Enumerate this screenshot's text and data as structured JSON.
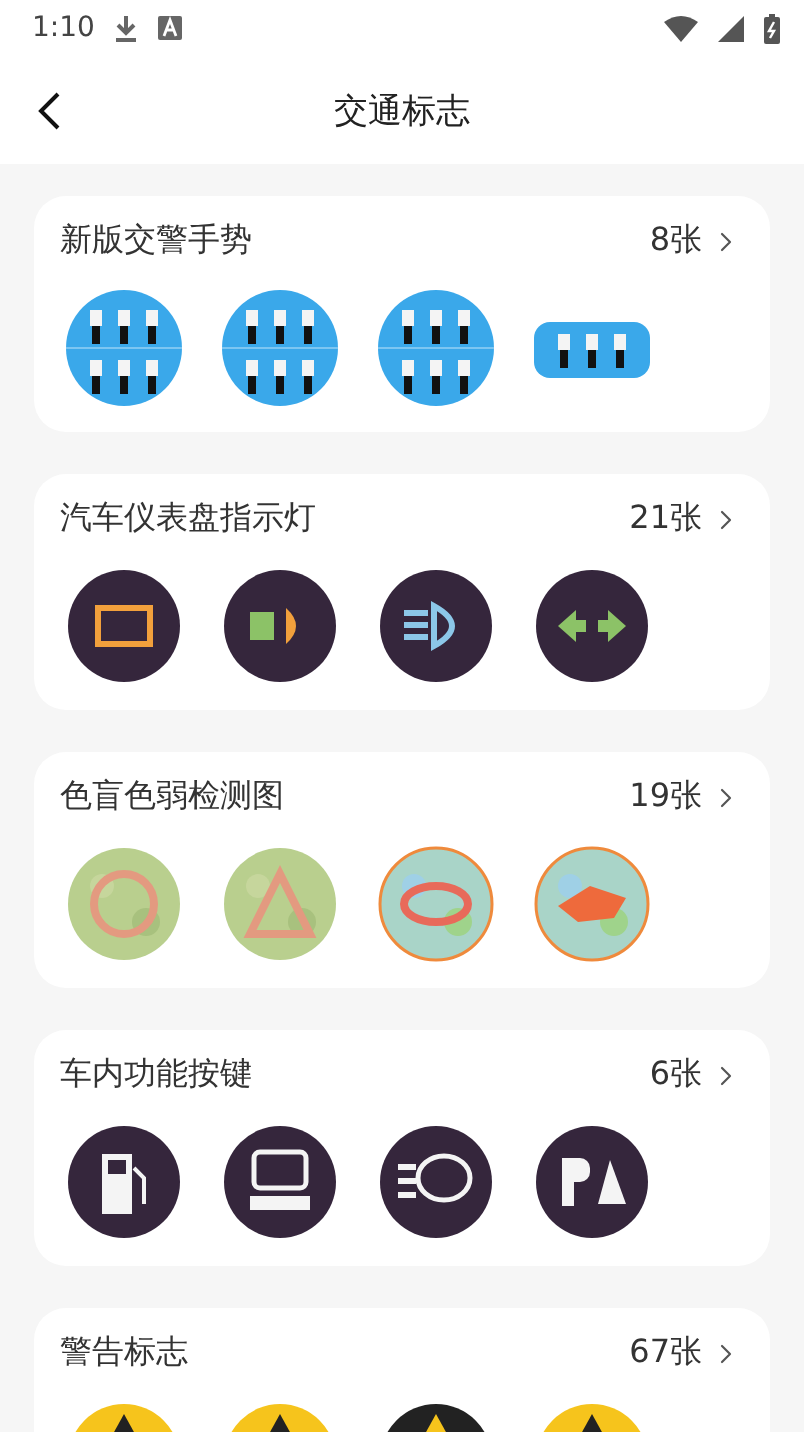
{
  "status_bar": {
    "time": "1:10"
  },
  "header": {
    "title": "交通标志"
  },
  "sections": [
    {
      "title": "新版交警手势",
      "count": "8张"
    },
    {
      "title": "汽车仪表盘指示灯",
      "count": "21张"
    },
    {
      "title": "色盲色弱检测图",
      "count": "19张"
    },
    {
      "title": "车内功能按键",
      "count": "6张"
    },
    {
      "title": "警告标志",
      "count": "67张"
    }
  ]
}
